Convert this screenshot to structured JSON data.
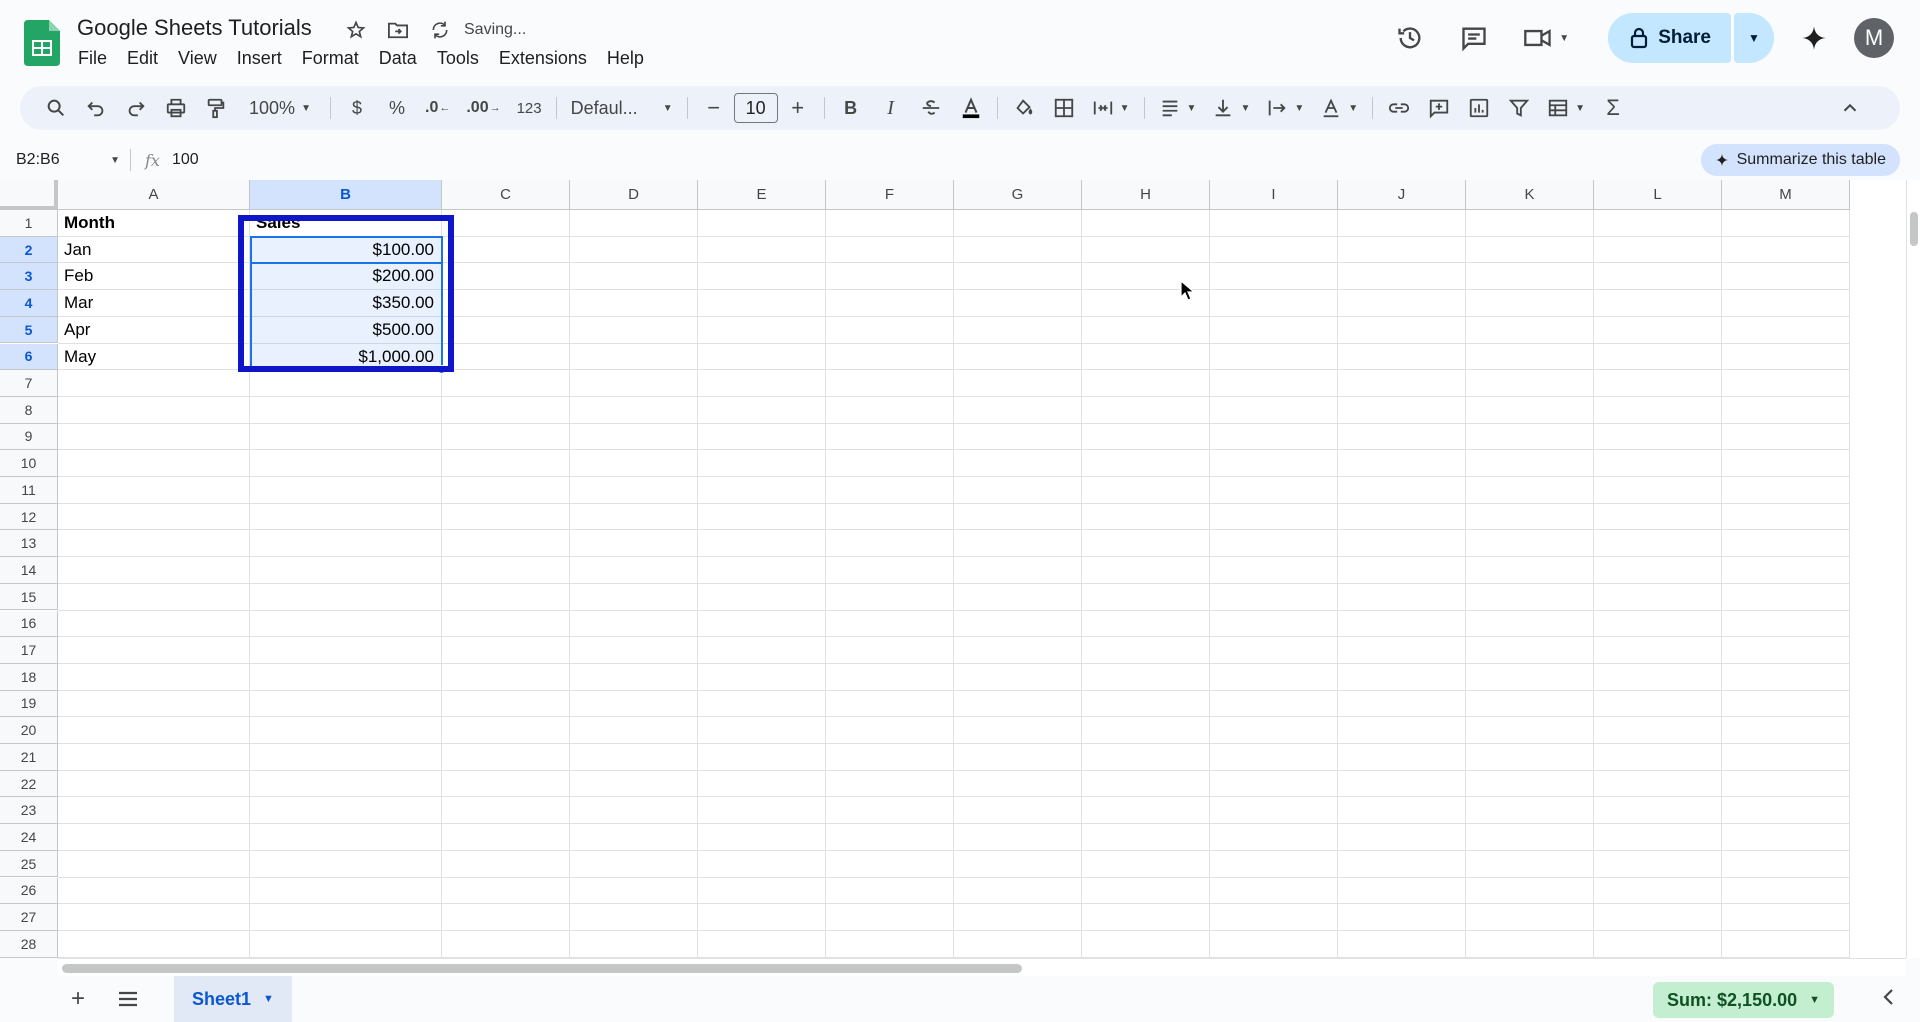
{
  "app": {
    "title": "Google Sheets Tutorials",
    "status": "Saving...",
    "menu": [
      "File",
      "Edit",
      "View",
      "Insert",
      "Format",
      "Data",
      "Tools",
      "Extensions",
      "Help"
    ],
    "share_label": "Share",
    "avatar_initial": "M"
  },
  "toolbar": {
    "zoom": "100%",
    "currency": "$",
    "percent": "%",
    "dec_decrease": ".0",
    "dec_increase": ".00",
    "number_format": "123",
    "font": "Defaul...",
    "font_size": "10",
    "bold": "B",
    "italic": "I",
    "sum_icon": "Σ"
  },
  "formula_bar": {
    "name_box": "B2:B6",
    "fx": "fx",
    "value": "100",
    "summarize_label": "Summarize this table"
  },
  "grid": {
    "columns": [
      "A",
      "B",
      "C",
      "D",
      "E",
      "F",
      "G",
      "H",
      "I",
      "J",
      "K",
      "L",
      "M"
    ],
    "rows": [
      "1",
      "2",
      "3",
      "4",
      "5",
      "6",
      "7",
      "8",
      "9",
      "10",
      "11",
      "12",
      "13",
      "14",
      "15",
      "16",
      "17",
      "18",
      "19",
      "20",
      "21",
      "22",
      "23",
      "24",
      "25",
      "26",
      "27",
      "28"
    ],
    "selected_column": "B",
    "selected_rows": [
      "2",
      "3",
      "4",
      "5",
      "6"
    ],
    "header_a": "Month",
    "header_b": "Sales",
    "data": [
      {
        "month": "Jan",
        "sales": "$100.00"
      },
      {
        "month": "Feb",
        "sales": "$200.00"
      },
      {
        "month": "Mar",
        "sales": "$350.00"
      },
      {
        "month": "Apr",
        "sales": "$500.00"
      },
      {
        "month": "May",
        "sales": "$1,000.00"
      }
    ]
  },
  "bottom": {
    "sheet_name": "Sheet1",
    "sum_label": "Sum: $2,150.00"
  },
  "colors": {
    "accent": "#1a73e8",
    "annotation": "#0f16c8",
    "share_bg": "#c2e7ff",
    "sum_bg": "#c4eed0"
  }
}
